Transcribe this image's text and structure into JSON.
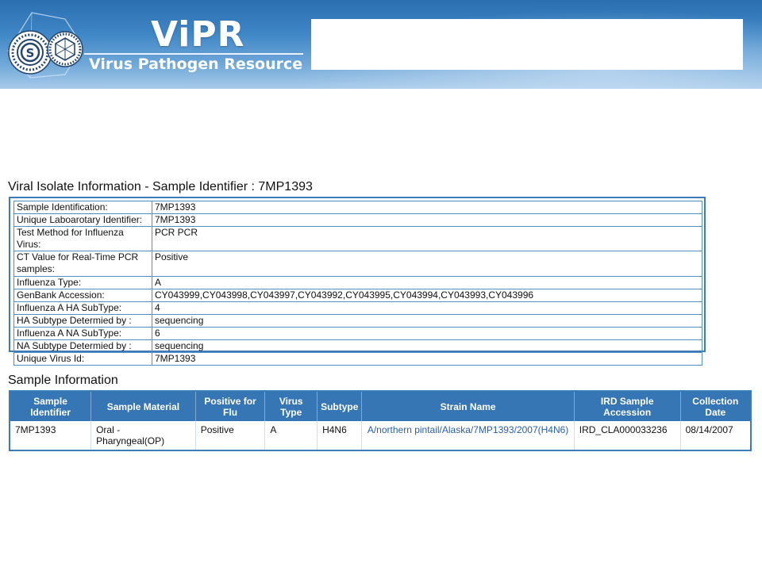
{
  "header": {
    "logo_title": "ViPR",
    "logo_subtitle": "Virus Pathogen Resource",
    "colors": {
      "banner_top": "#2b6fb0",
      "banner_bottom": "#a9cbea",
      "table_border": "#3a7bb8",
      "table_header": "#3676b4",
      "link": "#2a5ea8"
    },
    "icons": [
      "virus-s-logo-icon",
      "virus-capsid-logo-icon"
    ]
  },
  "isolate": {
    "title": "Viral Isolate Information - Sample Identifier : 7MP1393",
    "rows": [
      {
        "label": "Sample Identification:",
        "value": "7MP1393"
      },
      {
        "label": "Unique Laboarotary Identifier:",
        "value": "7MP1393"
      },
      {
        "label": "Test Method for Influenza Virus:",
        "value": "PCR PCR"
      },
      {
        "label": "CT Value for Real-Time PCR samples:",
        "value": "Positive"
      },
      {
        "label": "Influenza Type:",
        "value": "A"
      },
      {
        "label": "GenBank Accession:",
        "value": "CY043999,CY043998,CY043997,CY043992,CY043995,CY043994,CY043993,CY043996"
      },
      {
        "label": "Influenza A HA SubType:",
        "value": "4"
      },
      {
        "label": "HA Subtype Determied by :",
        "value": "sequencing"
      },
      {
        "label": "Influenza A NA SubType:",
        "value": "6"
      },
      {
        "label": "NA Subtype Determied by :",
        "value": "sequencing"
      },
      {
        "label": "Unique Virus Id:",
        "value": "7MP1393"
      }
    ]
  },
  "sample": {
    "title": "Sample Information",
    "columns": [
      "Sample Identifier",
      "Sample Material",
      "Positive for Flu",
      "Virus Type",
      "Subtype",
      "Strain Name",
      "IRD Sample Accession",
      "Collection Date"
    ],
    "rows": [
      {
        "sample_identifier": "7MP1393",
        "sample_material": "Oral - Pharyngeal(OP)",
        "positive_for_flu": "Positive",
        "virus_type": "A",
        "subtype": "H4N6",
        "strain_name": "A/northern pintail/Alaska/7MP1393/2007(H4N6)",
        "ird_sample_accession": "IRD_CLA000033236",
        "collection_date": "08/14/2007"
      }
    ]
  }
}
